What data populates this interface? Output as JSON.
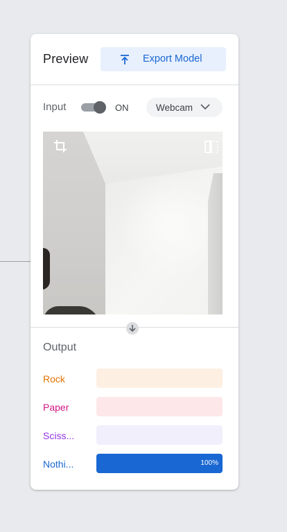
{
  "header": {
    "title": "Preview",
    "export_label": "Export Model"
  },
  "input": {
    "label": "Input",
    "toggle_state": "ON",
    "toggle_on": true,
    "source": "Webcam"
  },
  "output": {
    "title": "Output",
    "classes": [
      {
        "label": "Rock",
        "label_color": "#e37400",
        "bar_bg": "#feefe3",
        "fill_color": "#e37400",
        "confidence": 0.0,
        "percent_text": ""
      },
      {
        "label": "Paper",
        "label_color": "#d01884",
        "bar_bg": "#fde7e9",
        "fill_color": "#d01884",
        "confidence": 0.0,
        "percent_text": ""
      },
      {
        "label": "Sciss...",
        "label_color": "#9334e6",
        "bar_bg": "#f1effc",
        "fill_color": "#9334e6",
        "confidence": 0.0,
        "percent_text": ""
      },
      {
        "label": "Nothi...",
        "label_color": "#1967d2",
        "bar_bg": "#e8f0fe",
        "fill_color": "#1967d2",
        "confidence": 1.0,
        "percent_text": "100%"
      }
    ]
  },
  "colors": {
    "accent": "#1967d2",
    "accent_bg": "#e8f0fe"
  },
  "icons": {
    "export": "upload-arrow-icon",
    "crop": "crop-icon",
    "flip": "flip-horizontal-icon",
    "dropdown": "chevron-down-icon",
    "flow": "arrow-down-circle-icon"
  }
}
